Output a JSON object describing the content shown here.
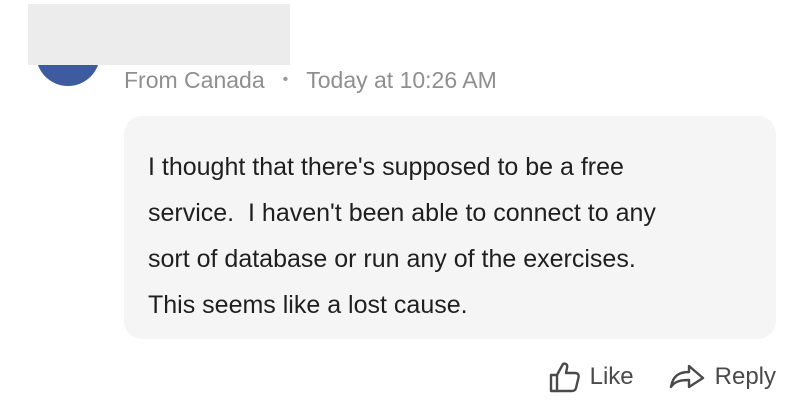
{
  "comment": {
    "author_name": "",
    "location": "From Canada",
    "separator": "•",
    "timestamp": "Today at 10:26 AM",
    "text": "I thought that there's supposed to be a free\nservice.  I haven't been able to connect to any\nsort of database or run any of the exercises.\nThis seems like a lost cause."
  },
  "actions": {
    "like_label": "Like",
    "like_icon": "thumbs-up-icon",
    "reply_label": "Reply",
    "reply_icon": "reply-arrow-icon"
  },
  "colors": {
    "avatar": "#3f5ba0",
    "bubble_background": "#f5f5f5",
    "meta_text": "#8f8f8f",
    "body_text": "#1f1f1f",
    "action_text": "#4a4a4a",
    "redaction": "#ececec"
  }
}
